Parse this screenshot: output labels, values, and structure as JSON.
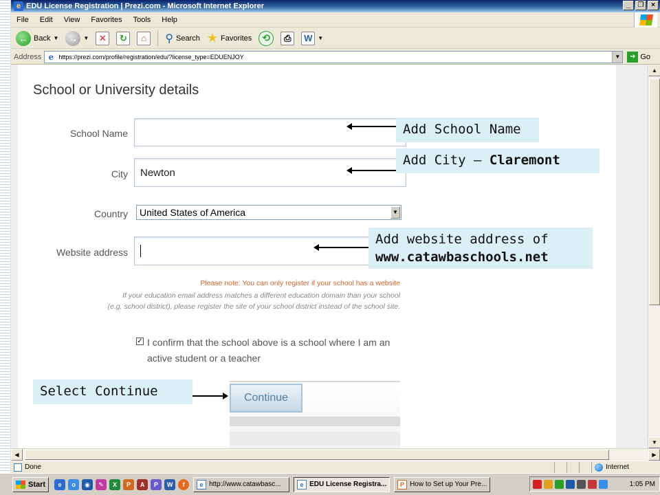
{
  "window": {
    "title": "EDU License Registration | Prezi.com - Microsoft Internet Explorer",
    "buttons": [
      "_",
      "❐",
      "×"
    ]
  },
  "menu": [
    "File",
    "Edit",
    "View",
    "Favorites",
    "Tools",
    "Help"
  ],
  "toolbar": {
    "back_label": "Back",
    "search_label": "Search",
    "favorites_label": "Favorites"
  },
  "address": {
    "label": "Address",
    "url": "https://prezi.com/profile/registration/edu/?license_type=EDUENJOY",
    "go_label": "Go"
  },
  "form": {
    "title": "School or University details",
    "school_name_label": "School Name",
    "school_name_value": "",
    "city_label": "City",
    "city_value": "Newton",
    "country_label": "Country",
    "country_value": "United States of America",
    "website_label": "Website address",
    "website_value": "",
    "note_warning": "Please note: You can only register if your school has a website",
    "note_line1": "If your education email address matches a different education domain than your school",
    "note_line2": "(e.g. school district), please register the site of your school district instead of the school site.",
    "confirm_text": "I confirm that the school above is a school where I am an active student or a teacher",
    "confirm_checked": true,
    "continue_label": "Continue"
  },
  "callouts": {
    "school": "Add School Name",
    "city_prefix": "Add City – ",
    "city_bold": "Claremont",
    "website_line1": "Add website address of",
    "website_bold": "www.catawbaschools.net",
    "continue": "Select Continue"
  },
  "status": {
    "text": "Done",
    "zone": "Internet"
  },
  "taskbar": {
    "start_label": "Start",
    "tasks": [
      {
        "label": "http://www.catawbasc...",
        "active": false
      },
      {
        "label": "EDU License Registra...",
        "active": true
      },
      {
        "label": "How to Set up Your Pre...",
        "active": false
      }
    ],
    "clock": "1:05 PM"
  },
  "colors": {
    "callout_bg": "#dbeff7",
    "title_bar": "#0a246a",
    "note_warning": "#d6622b",
    "continue_text": "#4f80a8"
  }
}
